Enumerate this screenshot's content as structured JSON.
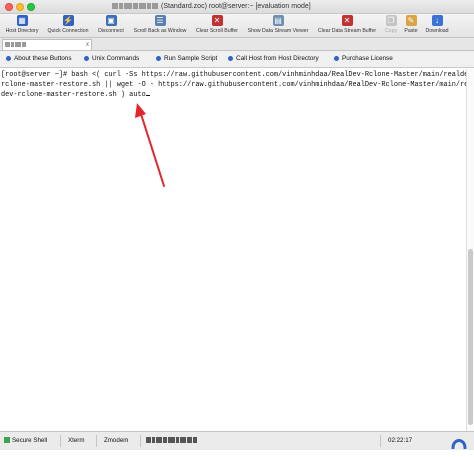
{
  "window": {
    "title": "(Standard.zoc) root@server:~ [evaluation mode]"
  },
  "toolbar": {
    "buttons": [
      {
        "label": "Host Directory",
        "icon": "host-directory-icon",
        "color": "#2f62c8",
        "enabled": true
      },
      {
        "label": "Quick Connection",
        "icon": "quick-connection-icon",
        "color": "#2f62c8",
        "enabled": true
      },
      {
        "label": "Disconnect",
        "icon": "disconnect-icon",
        "color": "#3b6fb4",
        "enabled": true
      },
      {
        "label": "Scroll Back as Window",
        "icon": "scroll-back-icon",
        "color": "#5b7fb0",
        "enabled": true
      },
      {
        "label": "Clear Scroll Buffer",
        "icon": "clear-scroll-icon",
        "color": "#c23030",
        "enabled": true
      },
      {
        "label": "Show Data Stream Viewer",
        "icon": "data-stream-viewer-icon",
        "color": "#6f8fb0",
        "enabled": true
      },
      {
        "label": "Clear Data Stream Buffer",
        "icon": "clear-data-stream-icon",
        "color": "#c23030",
        "enabled": true
      },
      {
        "label": "Copy",
        "icon": "copy-icon",
        "color": "#c4c4c4",
        "enabled": false
      },
      {
        "label": "Paste",
        "icon": "paste-icon",
        "color": "#d9a441",
        "enabled": true
      },
      {
        "label": "Download",
        "icon": "download-icon",
        "color": "#3a72d8",
        "enabled": true
      }
    ]
  },
  "tabs": [
    {
      "label": "root@server:~",
      "close": "x"
    }
  ],
  "user_buttons": [
    {
      "label": "About these Buttons"
    },
    {
      "label": "Unix Commands"
    },
    {
      "label": "Run Sample Script"
    },
    {
      "label": "Call Host from Host Directory"
    },
    {
      "label": "Purchase License"
    }
  ],
  "terminal": {
    "lines": [
      "[root@server ~]# bash <( curl -Ss https://raw.githubusercontent.com/vinhminhdaa/RealDev-Rclone-Master/main/realdev-",
      "rclone-master-restore.sh || wget -O - https://raw.githubusercontent.com/vinhminhdaa/RealDev-Rclone-Master/main/real",
      "dev-rclone-master-restore.sh ) auto"
    ]
  },
  "annotation": {
    "color": "#e3262b"
  },
  "statusbar": {
    "emulation": "Secure Shell",
    "terminal": "Xterm",
    "transfer": "Zmodem",
    "time": "02:22:17"
  }
}
